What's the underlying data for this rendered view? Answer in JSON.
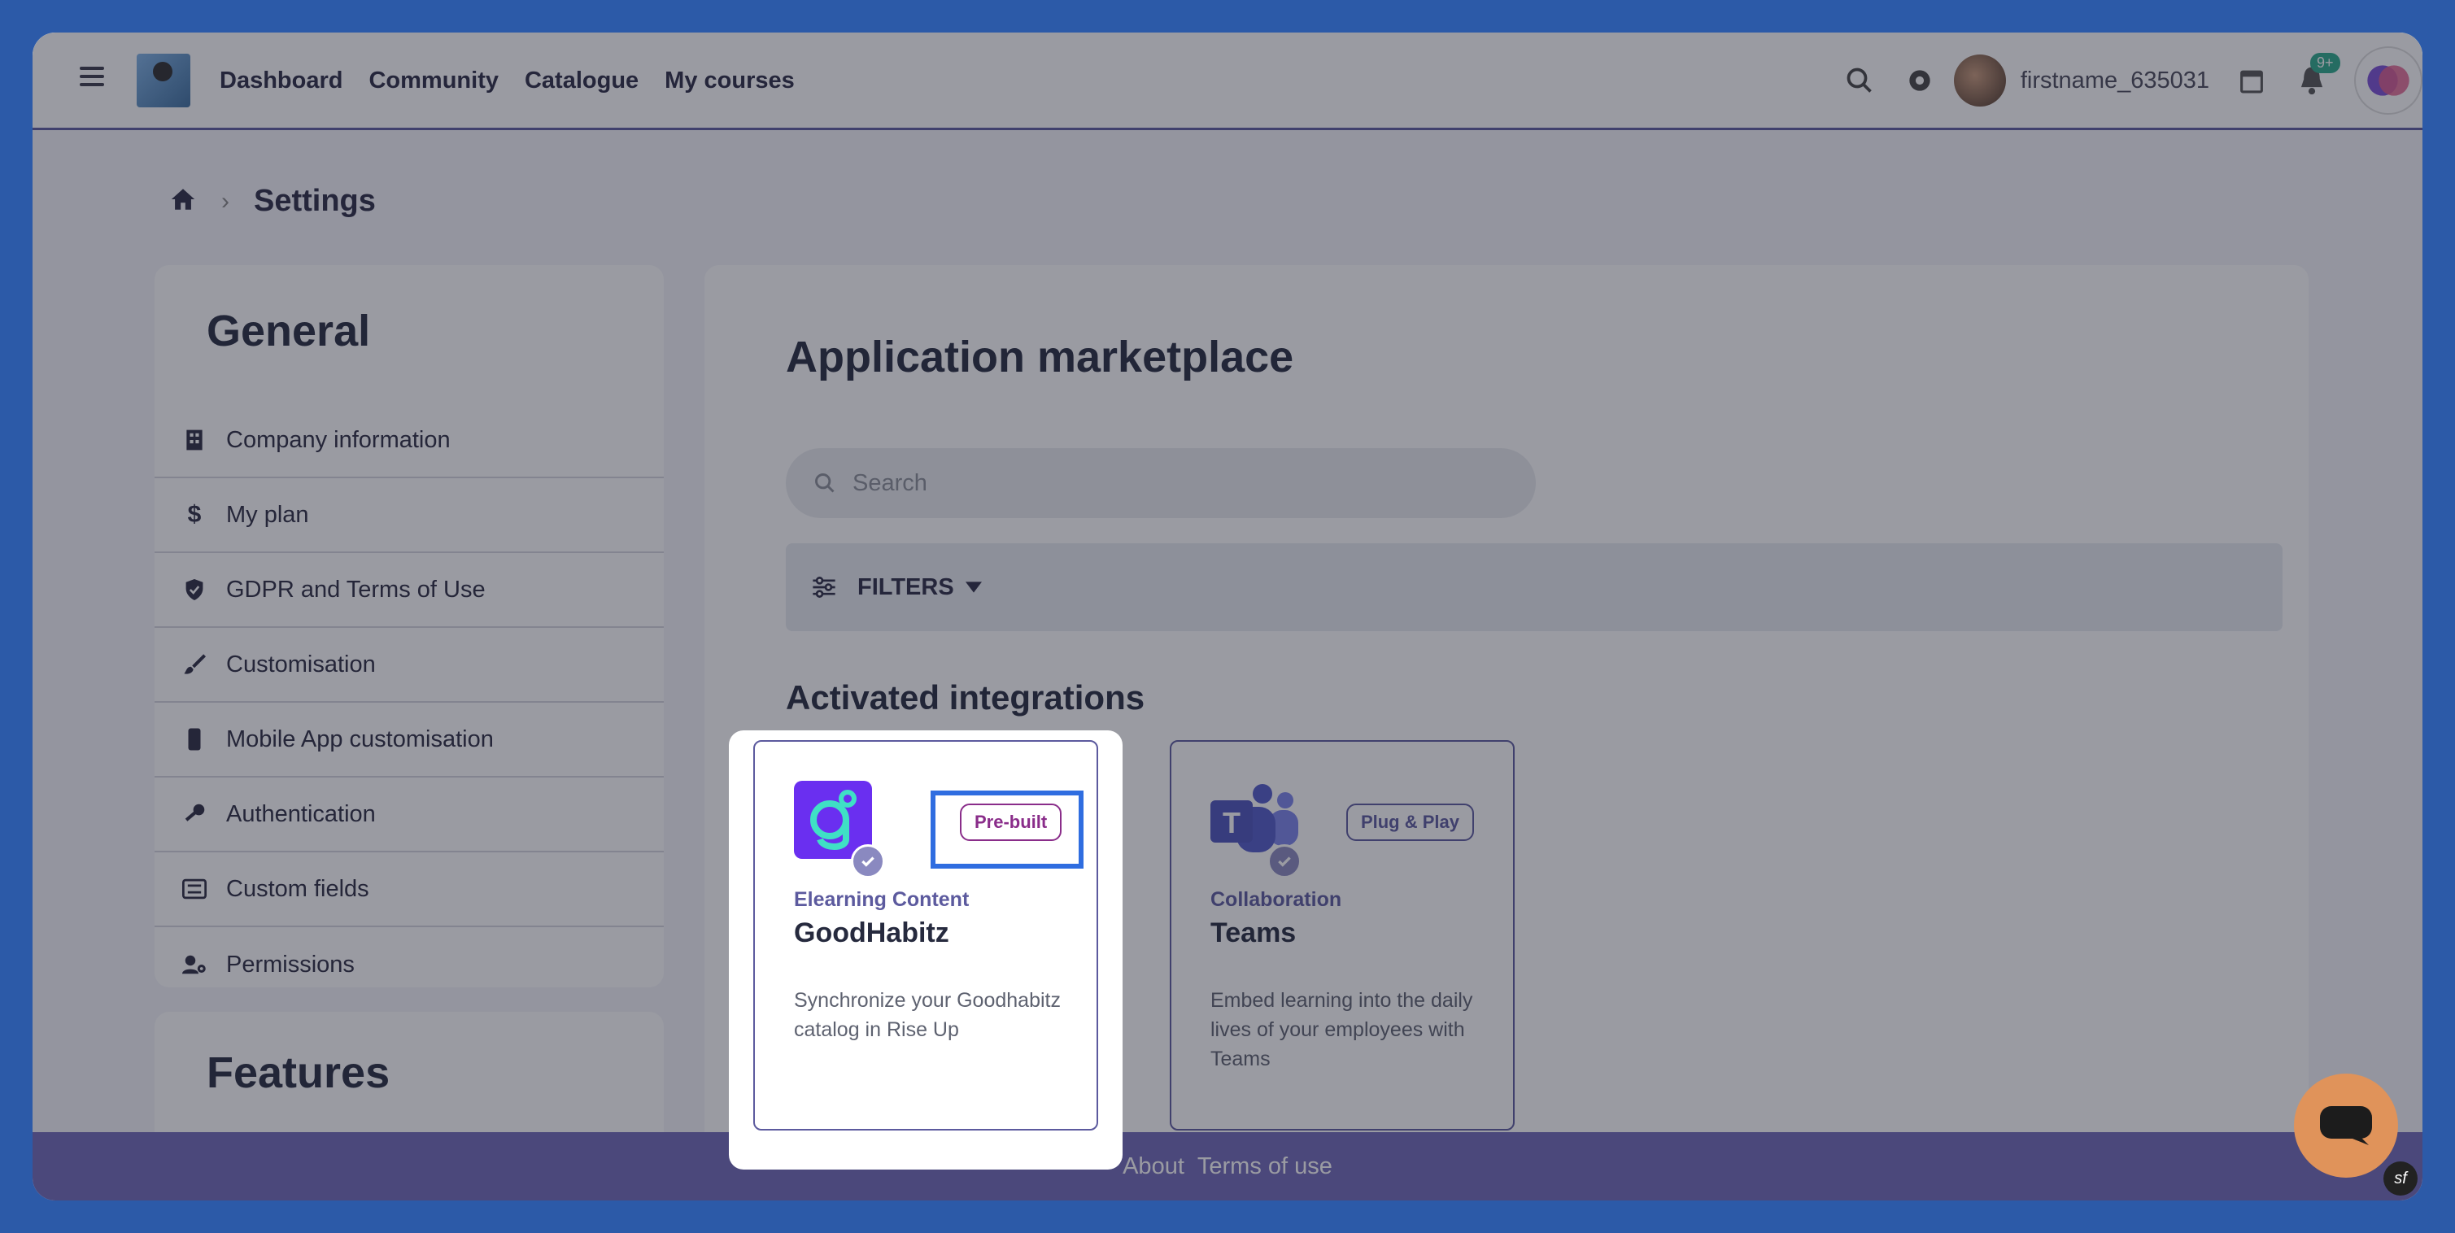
{
  "topbar": {
    "nav": [
      "Dashboard",
      "Community",
      "Catalogue",
      "My courses"
    ],
    "username": "firstname_635031",
    "notification_badge": "9+"
  },
  "breadcrumb": {
    "title": "Settings"
  },
  "sidebar": {
    "general_heading": "General",
    "items": [
      {
        "label": "Company information",
        "icon": "building-icon"
      },
      {
        "label": "My plan",
        "icon": "dollar-icon"
      },
      {
        "label": "GDPR and Terms of Use",
        "icon": "shield-icon"
      },
      {
        "label": "Customisation",
        "icon": "brush-icon"
      },
      {
        "label": "Mobile App customisation",
        "icon": "mobile-icon"
      },
      {
        "label": "Authentication",
        "icon": "key-icon"
      },
      {
        "label": "Custom fields",
        "icon": "list-icon"
      },
      {
        "label": "Permissions",
        "icon": "user-gear-icon"
      }
    ],
    "features_heading": "Features"
  },
  "main": {
    "title": "Application marketplace",
    "search_placeholder": "Search",
    "filters_label": "FILTERS",
    "subtitle": "Activated integrations",
    "cards": [
      {
        "category": "Elearning Content",
        "name": "GoodHabitz",
        "tag": "Pre-built",
        "description": "Synchronize your Goodhabitz catalog in Rise Up",
        "logo_color": "#6a2ff0"
      },
      {
        "category": "Collaboration",
        "name": "Teams",
        "tag": "Plug & Play",
        "description": "Embed learning into the daily lives of your employees with Teams",
        "logo_color": "#5059c9"
      }
    ]
  },
  "footer": {
    "about": "About",
    "terms": "Terms of use"
  },
  "colors": {
    "accent": "#5c5a9e",
    "footer": "#7069b8",
    "highlight": "#2f6de0",
    "chat": "#e0935a"
  }
}
